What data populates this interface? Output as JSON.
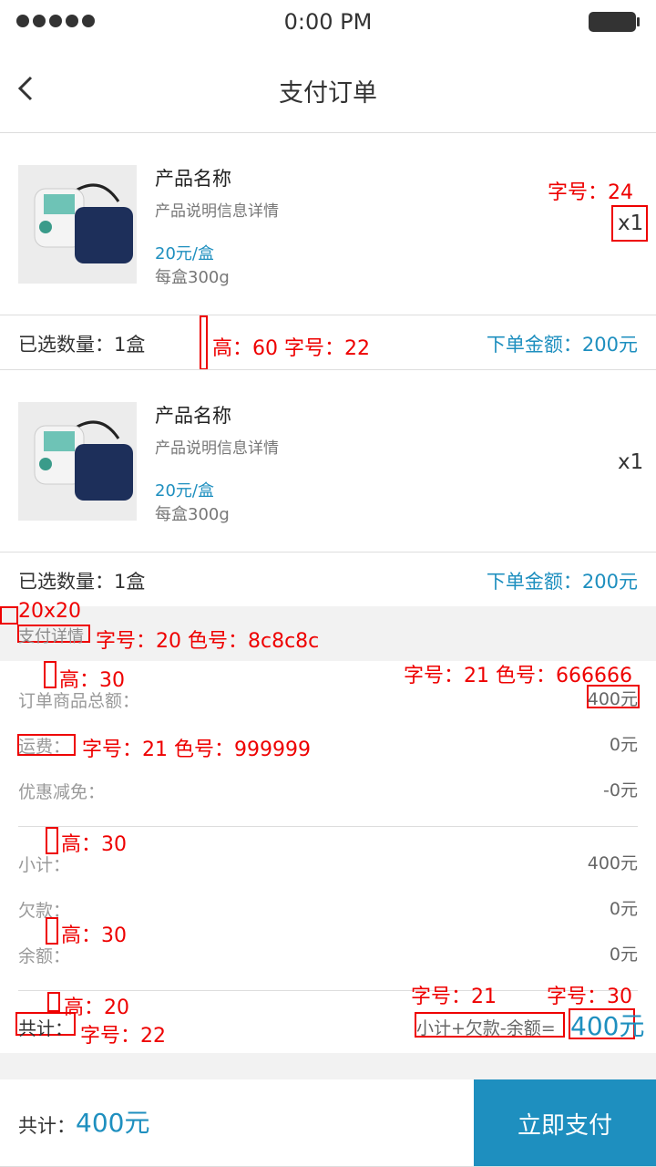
{
  "status_bar": {
    "time": "0:00 PM"
  },
  "nav": {
    "title": "支付订单"
  },
  "products": [
    {
      "name": "产品名称",
      "desc": "产品说明信息详情",
      "price": "20元/盒",
      "weight": "每盒300g",
      "qty": "x1",
      "selected_label": "已选数量：1盒",
      "order_amount": "下单金额：200元"
    },
    {
      "name": "产品名称",
      "desc": "产品说明信息详情",
      "price": "20元/盒",
      "weight": "每盒300g",
      "qty": "x1",
      "selected_label": "已选数量：1盒",
      "order_amount": "下单金额：200元"
    }
  ],
  "details": {
    "section_title": "支付详情",
    "rows": [
      {
        "label": "订单商品总额：",
        "value": "400元"
      },
      {
        "label": "运费：",
        "value": "0元"
      },
      {
        "label": "优惠减免：",
        "value": "-0元"
      },
      {
        "label": "小计：",
        "value": "400元"
      },
      {
        "label": "欠款：",
        "value": "0元"
      },
      {
        "label": "余额：",
        "value": "0元"
      }
    ],
    "total_label": "共计：",
    "total_formula": "小计+欠款-余额=",
    "total_value": "400元"
  },
  "annotations": {
    "a1": "字号：24",
    "a2": "高：60  字号：22",
    "a3": "20x20",
    "a4": "字号：20  色号：8c8c8c",
    "a5": "高：30",
    "a6": "字号：21 色号：666666",
    "a7": "字号：21  色号：999999",
    "a8": "高：30",
    "a9": "高：30",
    "a10": "高：20",
    "a11": "字号：21",
    "a12": "字号：30",
    "a13": "字号：22"
  },
  "footer": {
    "total_label": "共计：",
    "total_value": "400元",
    "pay_button": "立即支付"
  },
  "colors": {
    "accent": "#1e8fbf",
    "annotation": "#ee0000"
  }
}
